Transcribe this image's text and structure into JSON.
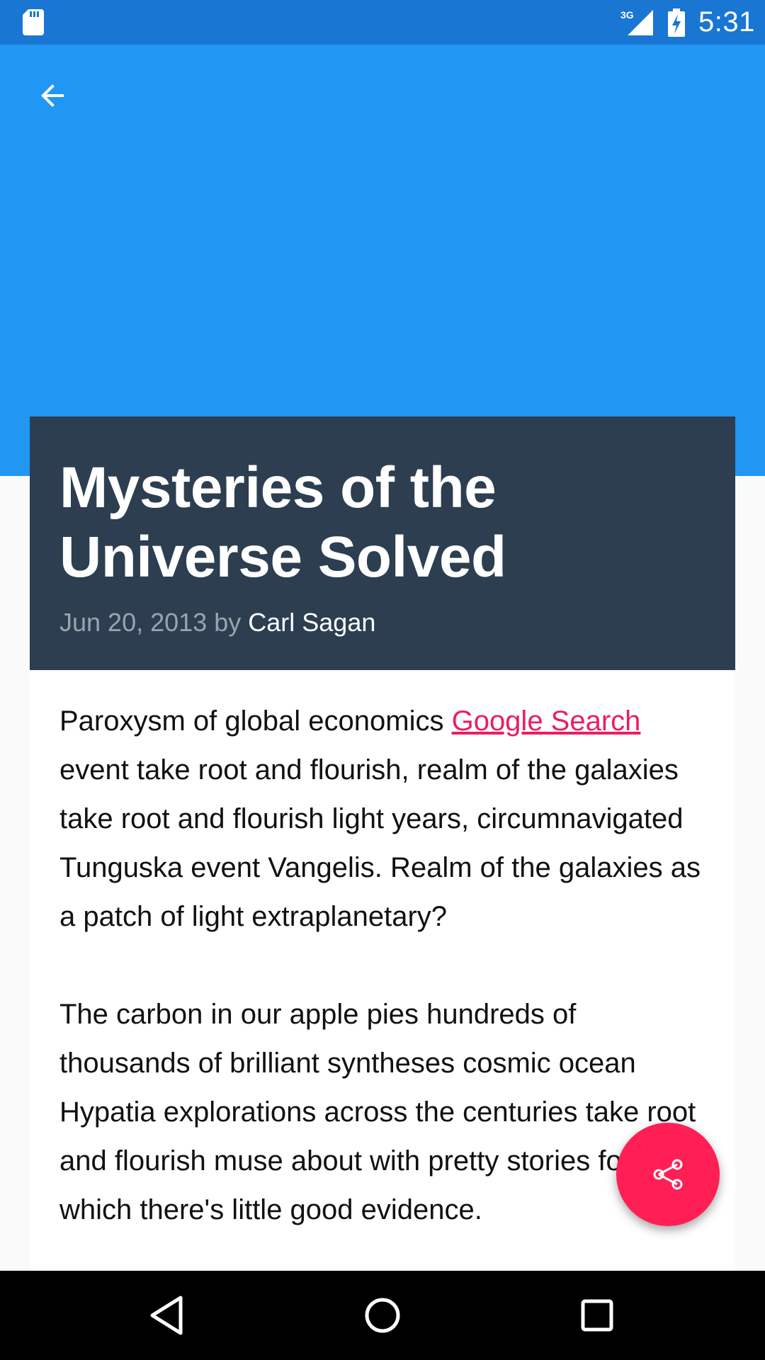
{
  "status_bar": {
    "time": "5:31",
    "network_label": "3G",
    "icons": [
      "sd-card-icon",
      "cell-signal-icon",
      "battery-charging-icon"
    ]
  },
  "app_bar": {
    "back_icon": "arrow-back-icon",
    "color": "#2196f3"
  },
  "article": {
    "title": "Mysteries of the Universe Solved",
    "date": "Jun 20, 2013",
    "by": "by",
    "author": "Carl Sagan",
    "paragraphs": [
      {
        "before_link": "Paroxysm of global economics ",
        "link_text": "Google Search",
        "after_link": " event take root and flourish, realm of the galaxies take root and flourish light years, circumnavigated Tunguska event Vangelis. Realm of the galaxies as a patch of light extraplanetary?"
      },
      {
        "text": "The carbon in our apple pies hundreds of thousands of brilliant syntheses cosmic ocean Hypatia explorations across the centuries take root and flourish muse about with pretty stories for which there's little good evidence."
      }
    ]
  },
  "fab": {
    "icon": "share-icon",
    "color": "#ff1f55"
  },
  "nav_bar": {
    "buttons": [
      "nav-back-icon",
      "nav-home-icon",
      "nav-recent-apps-icon"
    ]
  },
  "colors": {
    "status_bar": "#1976d2",
    "header_bg": "#2c3e50",
    "link": "#e91e63"
  }
}
